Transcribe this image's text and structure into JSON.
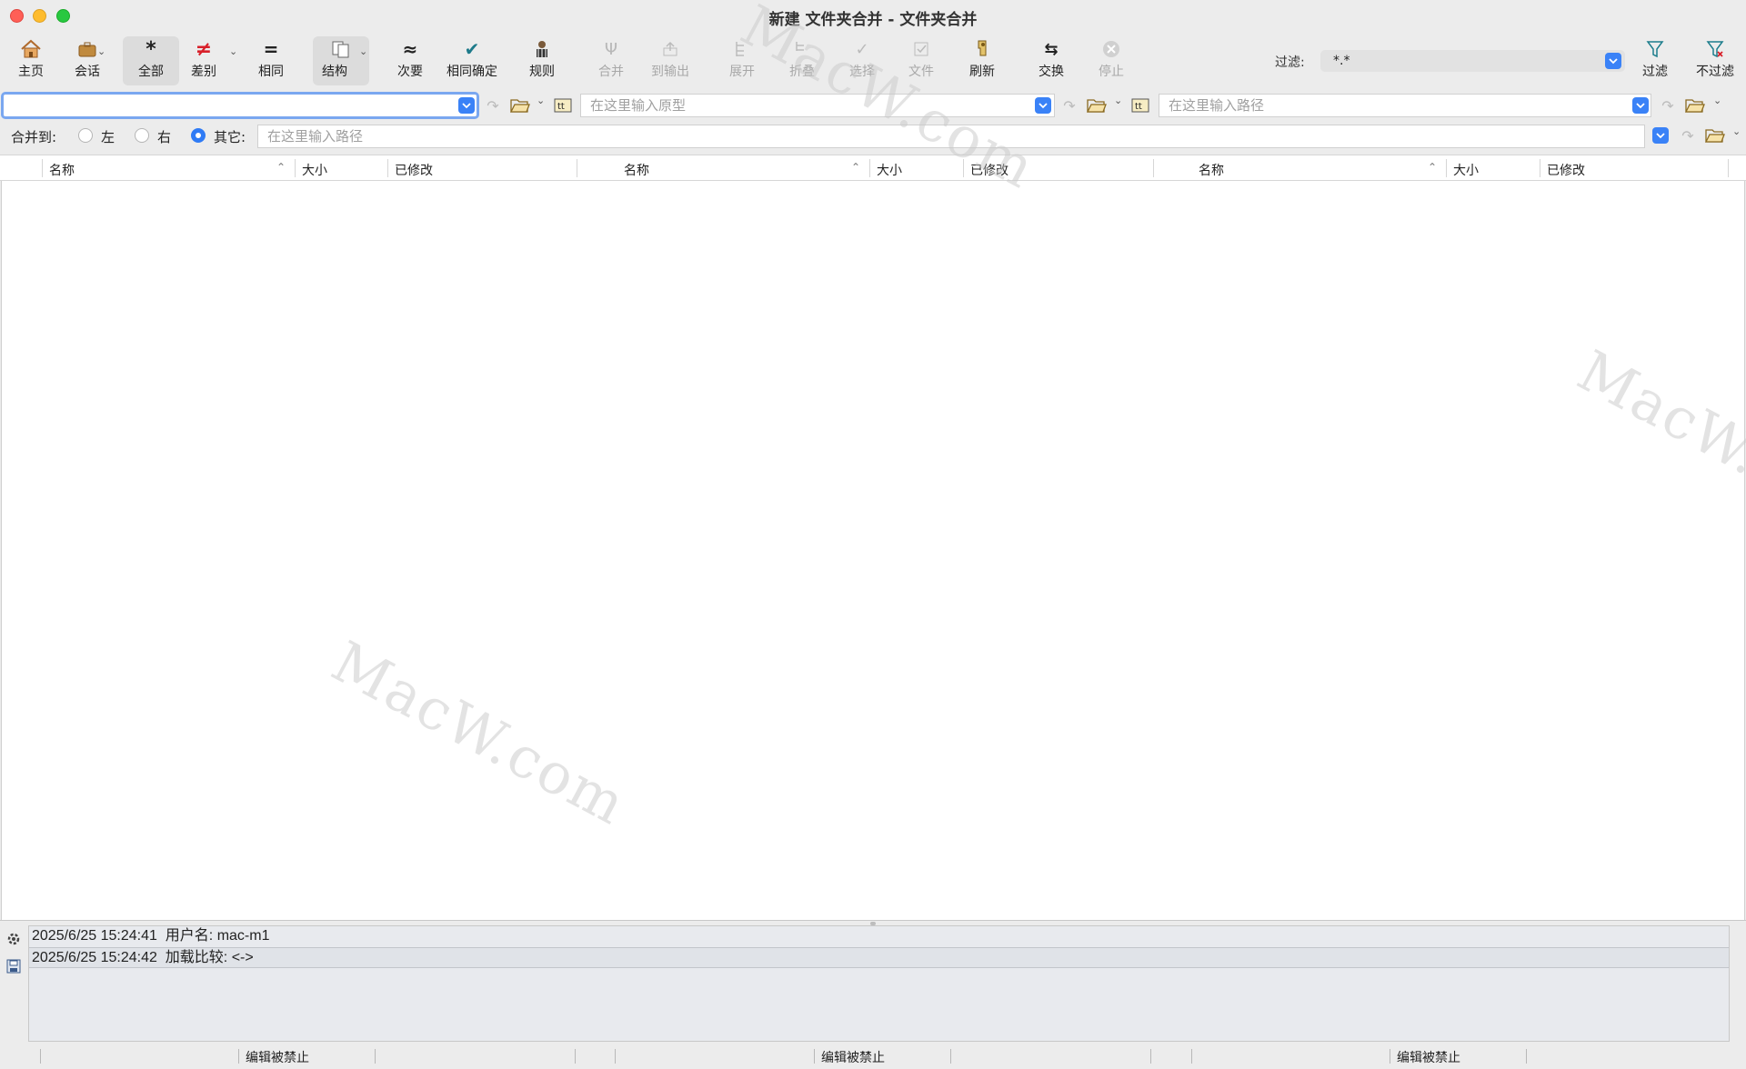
{
  "window": {
    "title": "新建 文件夹合并 - 文件夹合并"
  },
  "toolbar": {
    "home": "主页",
    "session": "会话",
    "all": "全部",
    "diff": "差别",
    "same": "相同",
    "structure": "结构",
    "minor": "次要",
    "same_confirm": "相同确定",
    "rules": "规则",
    "merge": "合并",
    "to_output": "到输出",
    "expand": "展开",
    "collapse": "折叠",
    "select": "选择",
    "files": "文件",
    "refresh": "刷新",
    "swap": "交换",
    "stop": "停止",
    "filter_label": "过滤:",
    "filter_value": "*.*",
    "filter_btn": "过滤",
    "no_filter_btn": "不过滤"
  },
  "paths": {
    "left_value": "",
    "middle_placeholder": "在这里输入原型",
    "right_placeholder": "在这里输入路径",
    "merge_placeholder": "在这里输入路径"
  },
  "merge_to": {
    "label": "合并到:",
    "left": "左",
    "right": "右",
    "other": "其它:",
    "selected": "other"
  },
  "columns": {
    "name": "名称",
    "size": "大小",
    "modified": "已修改"
  },
  "log": [
    {
      "time": "2025/6/25 15:24:41",
      "text": "用户名:  mac-m1"
    },
    {
      "time": "2025/6/25 15:24:42",
      "text": "加载比较:  <->"
    }
  ],
  "status": {
    "pane1": "编辑被禁止",
    "pane2": "编辑被禁止",
    "pane3": "编辑被禁止"
  },
  "watermark": "MacW.com",
  "colors": {
    "accent": "#3a82f7",
    "focus_ring": "#7aa7f0"
  }
}
